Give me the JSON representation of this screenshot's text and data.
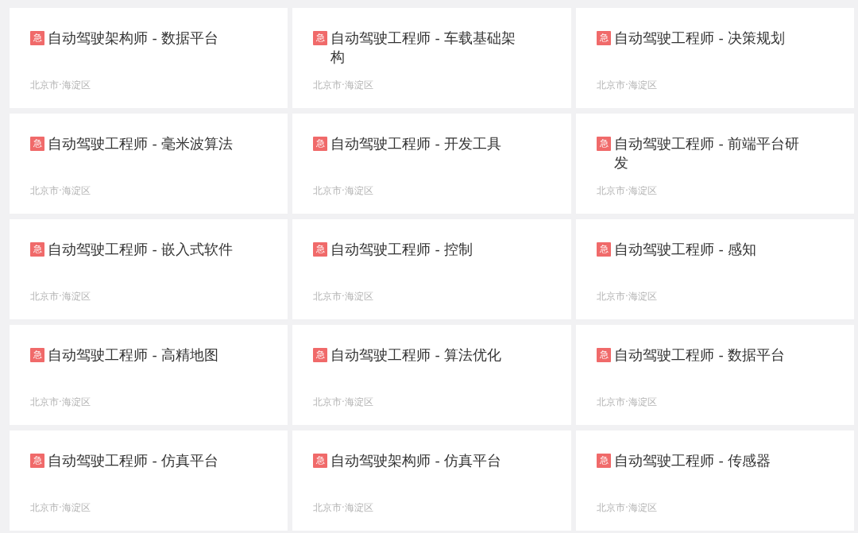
{
  "cards": [
    {
      "badge": "急",
      "title": "自动驾驶架构师 - 数据平台",
      "location": "北京市·海淀区"
    },
    {
      "badge": "急",
      "title": "自动驾驶工程师 - 车载基础架构",
      "location": "北京市·海淀区"
    },
    {
      "badge": "急",
      "title": "自动驾驶工程师 - 决策规划",
      "location": "北京市·海淀区"
    },
    {
      "badge": "急",
      "title": "自动驾驶工程师 - 毫米波算法",
      "location": "北京市·海淀区"
    },
    {
      "badge": "急",
      "title": "自动驾驶工程师 - 开发工具",
      "location": "北京市·海淀区"
    },
    {
      "badge": "急",
      "title": "自动驾驶工程师 - 前端平台研发",
      "location": "北京市·海淀区"
    },
    {
      "badge": "急",
      "title": "自动驾驶工程师 - 嵌入式软件",
      "location": "北京市·海淀区"
    },
    {
      "badge": "急",
      "title": "自动驾驶工程师 - 控制",
      "location": "北京市·海淀区"
    },
    {
      "badge": "急",
      "title": "自动驾驶工程师 - 感知",
      "location": "北京市·海淀区"
    },
    {
      "badge": "急",
      "title": "自动驾驶工程师 - 高精地图",
      "location": "北京市·海淀区"
    },
    {
      "badge": "急",
      "title": "自动驾驶工程师 - 算法优化",
      "location": "北京市·海淀区"
    },
    {
      "badge": "急",
      "title": "自动驾驶工程师 - 数据平台",
      "location": "北京市·海淀区"
    },
    {
      "badge": "急",
      "title": "自动驾驶工程师 - 仿真平台",
      "location": "北京市·海淀区"
    },
    {
      "badge": "急",
      "title": "自动驾驶架构师 - 仿真平台",
      "location": "北京市·海淀区"
    },
    {
      "badge": "急",
      "title": "自动驾驶工程师 - 传感器",
      "location": "北京市·海淀区"
    }
  ]
}
